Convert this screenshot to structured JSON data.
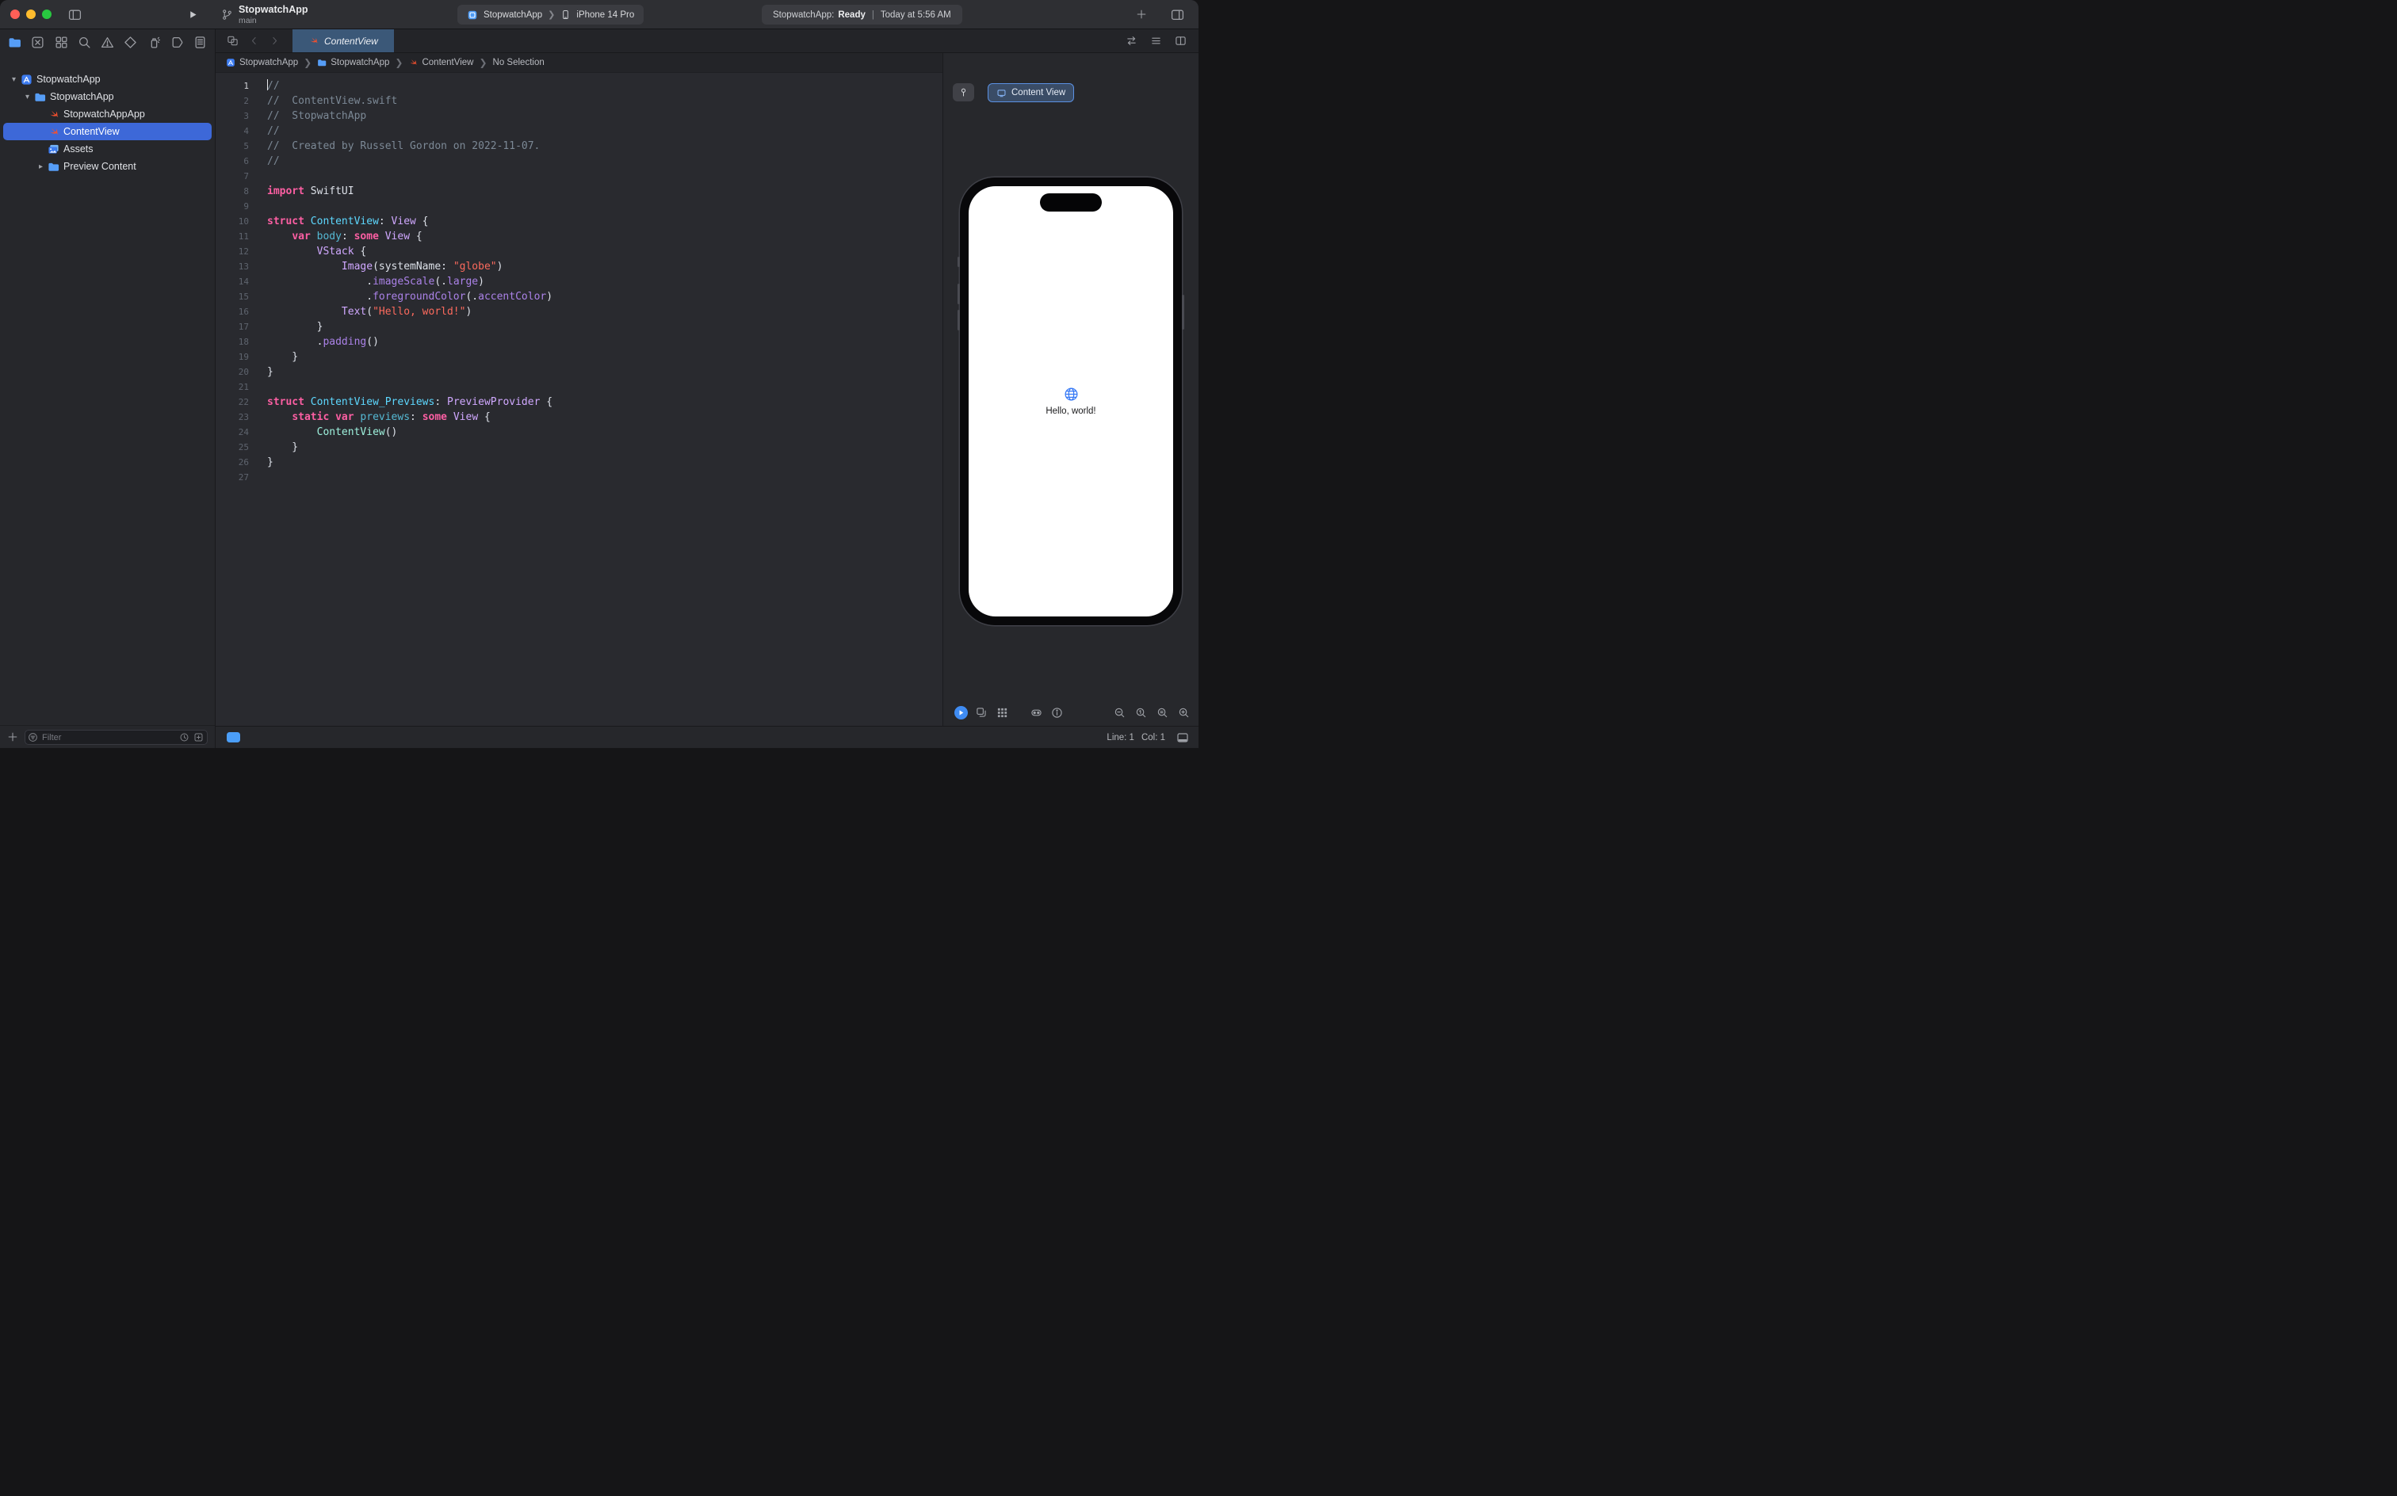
{
  "colors": {
    "accent_blue": "#4d9bf5",
    "selection_blue": "#3d68d8",
    "active_tab_blue": "#3b5878",
    "swift_orange": "#f4502e",
    "globe_blue": "#3478f6",
    "traffic_red": "#ff5f57",
    "traffic_yellow": "#febc2e",
    "traffic_green": "#28c840"
  },
  "toolbar": {
    "project_name": "StopwatchApp",
    "branch_name": "main",
    "run_destination": {
      "scheme": "StopwatchApp",
      "device": "iPhone 14 Pro"
    },
    "activity": {
      "prefix": "StopwatchApp:",
      "status": "Ready",
      "divider": "|",
      "detail": "Today at 5:56 AM"
    }
  },
  "navigator": {
    "bar_items": [
      {
        "icon": "folder",
        "name": "project-navigator-button",
        "active": true
      },
      {
        "icon": "source-control",
        "name": "source-control-navigator-button",
        "active": false
      },
      {
        "icon": "symbols",
        "name": "symbols-navigator-button",
        "active": false
      },
      {
        "icon": "magnifier",
        "name": "find-navigator-button",
        "active": false
      },
      {
        "icon": "warning",
        "name": "issues-navigator-button",
        "active": false
      },
      {
        "icon": "diamond",
        "name": "tests-navigator-button",
        "active": false
      },
      {
        "icon": "spray",
        "name": "debug-navigator-button",
        "active": false
      },
      {
        "icon": "breakpoint",
        "name": "breakpoints-navigator-button",
        "active": false
      },
      {
        "icon": "report",
        "name": "reports-navigator-button",
        "active": false
      }
    ],
    "items": [
      {
        "label": "StopwatchApp",
        "icon": "project",
        "depth": 0,
        "chevron": "down",
        "selected": false
      },
      {
        "label": "StopwatchApp",
        "icon": "folder",
        "depth": 1,
        "chevron": "down",
        "selected": false
      },
      {
        "label": "StopwatchAppApp",
        "icon": "swift",
        "depth": 2,
        "chevron": "none",
        "selected": false
      },
      {
        "label": "ContentView",
        "icon": "swift",
        "depth": 2,
        "chevron": "none",
        "selected": true
      },
      {
        "label": "Assets",
        "icon": "assets",
        "depth": 2,
        "chevron": "none",
        "selected": false
      },
      {
        "label": "Preview Content",
        "icon": "folder",
        "depth": 2,
        "chevron": "right",
        "selected": false
      }
    ],
    "filter_placeholder": "Filter",
    "filter_icons_right": [
      "clock",
      "plus-square"
    ]
  },
  "editor": {
    "tab": {
      "label": "ContentView",
      "icon": "swift"
    },
    "tabbar_icons_right": [
      {
        "icon": "swap",
        "name": "code-review-button"
      },
      {
        "icon": "list",
        "name": "editor-options-button"
      },
      {
        "icon": "split",
        "name": "add-editor-button"
      }
    ],
    "breadcrumbs": [
      {
        "label": "StopwatchApp",
        "icon": "project"
      },
      {
        "label": "StopwatchApp",
        "icon": "folder"
      },
      {
        "label": "ContentView",
        "icon": "swift"
      },
      {
        "label": "No Selection",
        "icon": "none"
      }
    ],
    "code_lines": [
      [
        {
          "c": "c",
          "t": "//"
        }
      ],
      [
        {
          "c": "c",
          "t": "//  ContentView.swift"
        }
      ],
      [
        {
          "c": "c",
          "t": "//  StopwatchApp"
        }
      ],
      [
        {
          "c": "c",
          "t": "//"
        }
      ],
      [
        {
          "c": "c",
          "t": "//  Created by Russell Gordon on 2022-11-07."
        }
      ],
      [
        {
          "c": "c",
          "t": "//"
        }
      ],
      [],
      [
        {
          "c": "k",
          "t": "import"
        },
        {
          "c": "p",
          "t": " SwiftUI"
        }
      ],
      [],
      [
        {
          "c": "k",
          "t": "struct"
        },
        {
          "c": "p",
          "t": " "
        },
        {
          "c": "d",
          "t": "ContentView"
        },
        {
          "c": "p",
          "t": ": "
        },
        {
          "c": "t",
          "t": "View"
        },
        {
          "c": "p",
          "t": " {"
        }
      ],
      [
        {
          "c": "p",
          "t": "    "
        },
        {
          "c": "k",
          "t": "var"
        },
        {
          "c": "p",
          "t": " "
        },
        {
          "c": "v",
          "t": "body"
        },
        {
          "c": "p",
          "t": ": "
        },
        {
          "c": "k",
          "t": "some"
        },
        {
          "c": "p",
          "t": " "
        },
        {
          "c": "t",
          "t": "View"
        },
        {
          "c": "p",
          "t": " {"
        }
      ],
      [
        {
          "c": "p",
          "t": "        "
        },
        {
          "c": "t",
          "t": "VStack"
        },
        {
          "c": "p",
          "t": " {"
        }
      ],
      [
        {
          "c": "p",
          "t": "            "
        },
        {
          "c": "t",
          "t": "Image"
        },
        {
          "c": "p",
          "t": "(systemName: "
        },
        {
          "c": "s",
          "t": "\"globe\""
        },
        {
          "c": "p",
          "t": ")"
        }
      ],
      [
        {
          "c": "p",
          "t": "                ."
        },
        {
          "c": "f",
          "t": "imageScale"
        },
        {
          "c": "p",
          "t": "(."
        },
        {
          "c": "f",
          "t": "large"
        },
        {
          "c": "p",
          "t": ")"
        }
      ],
      [
        {
          "c": "p",
          "t": "                ."
        },
        {
          "c": "f",
          "t": "foregroundColor"
        },
        {
          "c": "p",
          "t": "(."
        },
        {
          "c": "f",
          "t": "accentColor"
        },
        {
          "c": "p",
          "t": ")"
        }
      ],
      [
        {
          "c": "p",
          "t": "            "
        },
        {
          "c": "t",
          "t": "Text"
        },
        {
          "c": "p",
          "t": "("
        },
        {
          "c": "s",
          "t": "\"Hello, world!\""
        },
        {
          "c": "p",
          "t": ")"
        }
      ],
      [
        {
          "c": "p",
          "t": "        }"
        }
      ],
      [
        {
          "c": "p",
          "t": "        ."
        },
        {
          "c": "f",
          "t": "padding"
        },
        {
          "c": "p",
          "t": "()"
        }
      ],
      [
        {
          "c": "p",
          "t": "    }"
        }
      ],
      [
        {
          "c": "p",
          "t": "}"
        }
      ],
      [],
      [
        {
          "c": "k",
          "t": "struct"
        },
        {
          "c": "p",
          "t": " "
        },
        {
          "c": "d",
          "t": "ContentView_Previews"
        },
        {
          "c": "p",
          "t": ": "
        },
        {
          "c": "t",
          "t": "PreviewProvider"
        },
        {
          "c": "p",
          "t": " {"
        }
      ],
      [
        {
          "c": "p",
          "t": "    "
        },
        {
          "c": "k",
          "t": "static"
        },
        {
          "c": "p",
          "t": " "
        },
        {
          "c": "k",
          "t": "var"
        },
        {
          "c": "p",
          "t": " "
        },
        {
          "c": "v",
          "t": "previews"
        },
        {
          "c": "p",
          "t": ": "
        },
        {
          "c": "k",
          "t": "some"
        },
        {
          "c": "p",
          "t": " "
        },
        {
          "c": "t",
          "t": "View"
        },
        {
          "c": "p",
          "t": " {"
        }
      ],
      [
        {
          "c": "p",
          "t": "        "
        },
        {
          "c": "j",
          "t": "ContentView"
        },
        {
          "c": "p",
          "t": "()"
        }
      ],
      [
        {
          "c": "p",
          "t": "    }"
        }
      ],
      [
        {
          "c": "p",
          "t": "}"
        }
      ],
      []
    ]
  },
  "canvas": {
    "preview_name": "Content View",
    "device_preview": {
      "text": "Hello, world!"
    },
    "controls_left": [
      {
        "icon": "play-small",
        "name": "live-preview-button",
        "active": true
      },
      {
        "icon": "variants",
        "name": "preview-variants-button",
        "active": false
      },
      {
        "icon": "grid9",
        "name": "preview-device-grid-button",
        "active": false
      }
    ],
    "controls_mid": [
      {
        "icon": "device-settings",
        "name": "device-settings-button",
        "active": false
      },
      {
        "icon": "info",
        "name": "preview-info-button",
        "active": false
      }
    ],
    "zoom_controls": [
      {
        "icon": "zoom-out",
        "name": "zoom-out-button"
      },
      {
        "icon": "zoom-actual",
        "name": "zoom-actual-size-button"
      },
      {
        "icon": "zoom-fit",
        "name": "zoom-to-fit-button"
      },
      {
        "icon": "zoom-in",
        "name": "zoom-in-button"
      }
    ]
  },
  "status_bar": {
    "line_label": "Line: 1",
    "col_label": "Col: 1"
  }
}
